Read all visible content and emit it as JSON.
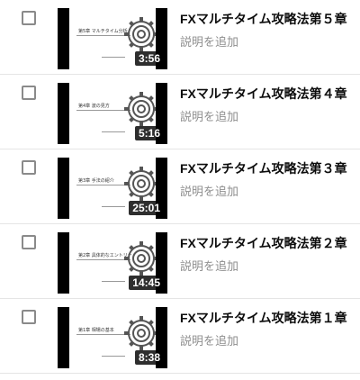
{
  "videos": [
    {
      "title": "FXマルチタイム攻略法第５章",
      "description_placeholder": "説明を追加",
      "duration": "3:56",
      "slide_title": "第5章 マルチタイム分析"
    },
    {
      "title": "FXマルチタイム攻略法第４章",
      "description_placeholder": "説明を追加",
      "duration": "5:16",
      "slide_title": "第4章 波の見方"
    },
    {
      "title": "FXマルチタイム攻略法第３章",
      "description_placeholder": "説明を追加",
      "duration": "25:01",
      "slide_title": "第3章 手法の紹介"
    },
    {
      "title": "FXマルチタイム攻略法第２章",
      "description_placeholder": "説明を追加",
      "duration": "14:45",
      "slide_title": "第2章 具体的なエントリー"
    },
    {
      "title": "FXマルチタイム攻略法第１章",
      "description_placeholder": "説明を追加",
      "duration": "8:38",
      "slide_title": "第1章 相場の基本"
    }
  ]
}
